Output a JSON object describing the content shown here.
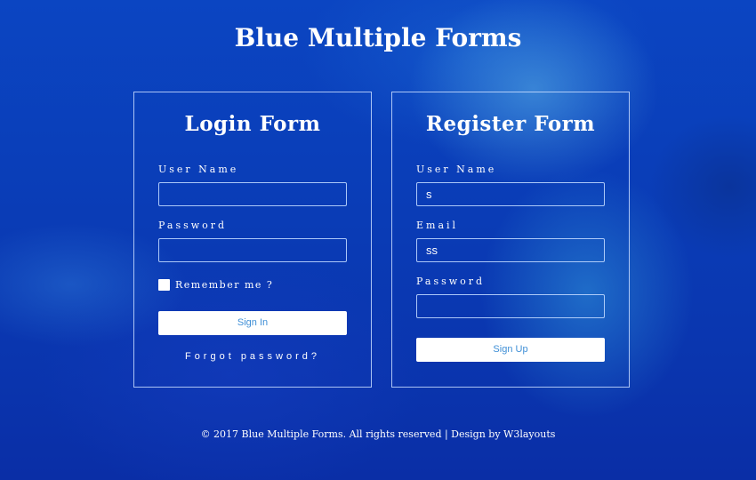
{
  "page": {
    "title": "Blue Multiple Forms"
  },
  "login_form": {
    "title": "Login Form",
    "username_label": "User Name",
    "username_value": "",
    "password_label": "Password",
    "password_value": "",
    "remember_label": "Remember me ?",
    "remember_checked": false,
    "submit_label": "Sign In",
    "forgot_label": "Forgot password?"
  },
  "register_form": {
    "title": "Register Form",
    "username_label": "User Name",
    "username_value": "s",
    "email_label": "Email",
    "email_value": "ss",
    "password_label": "Password",
    "password_value": "",
    "submit_label": "Sign Up"
  },
  "footer": {
    "text": "© 2017 Blue Multiple Forms. All rights reserved | Design by W3layouts"
  },
  "colors": {
    "background": "#0a3bb8",
    "button_text": "#3f8fd6",
    "border": "#c8dcff"
  }
}
